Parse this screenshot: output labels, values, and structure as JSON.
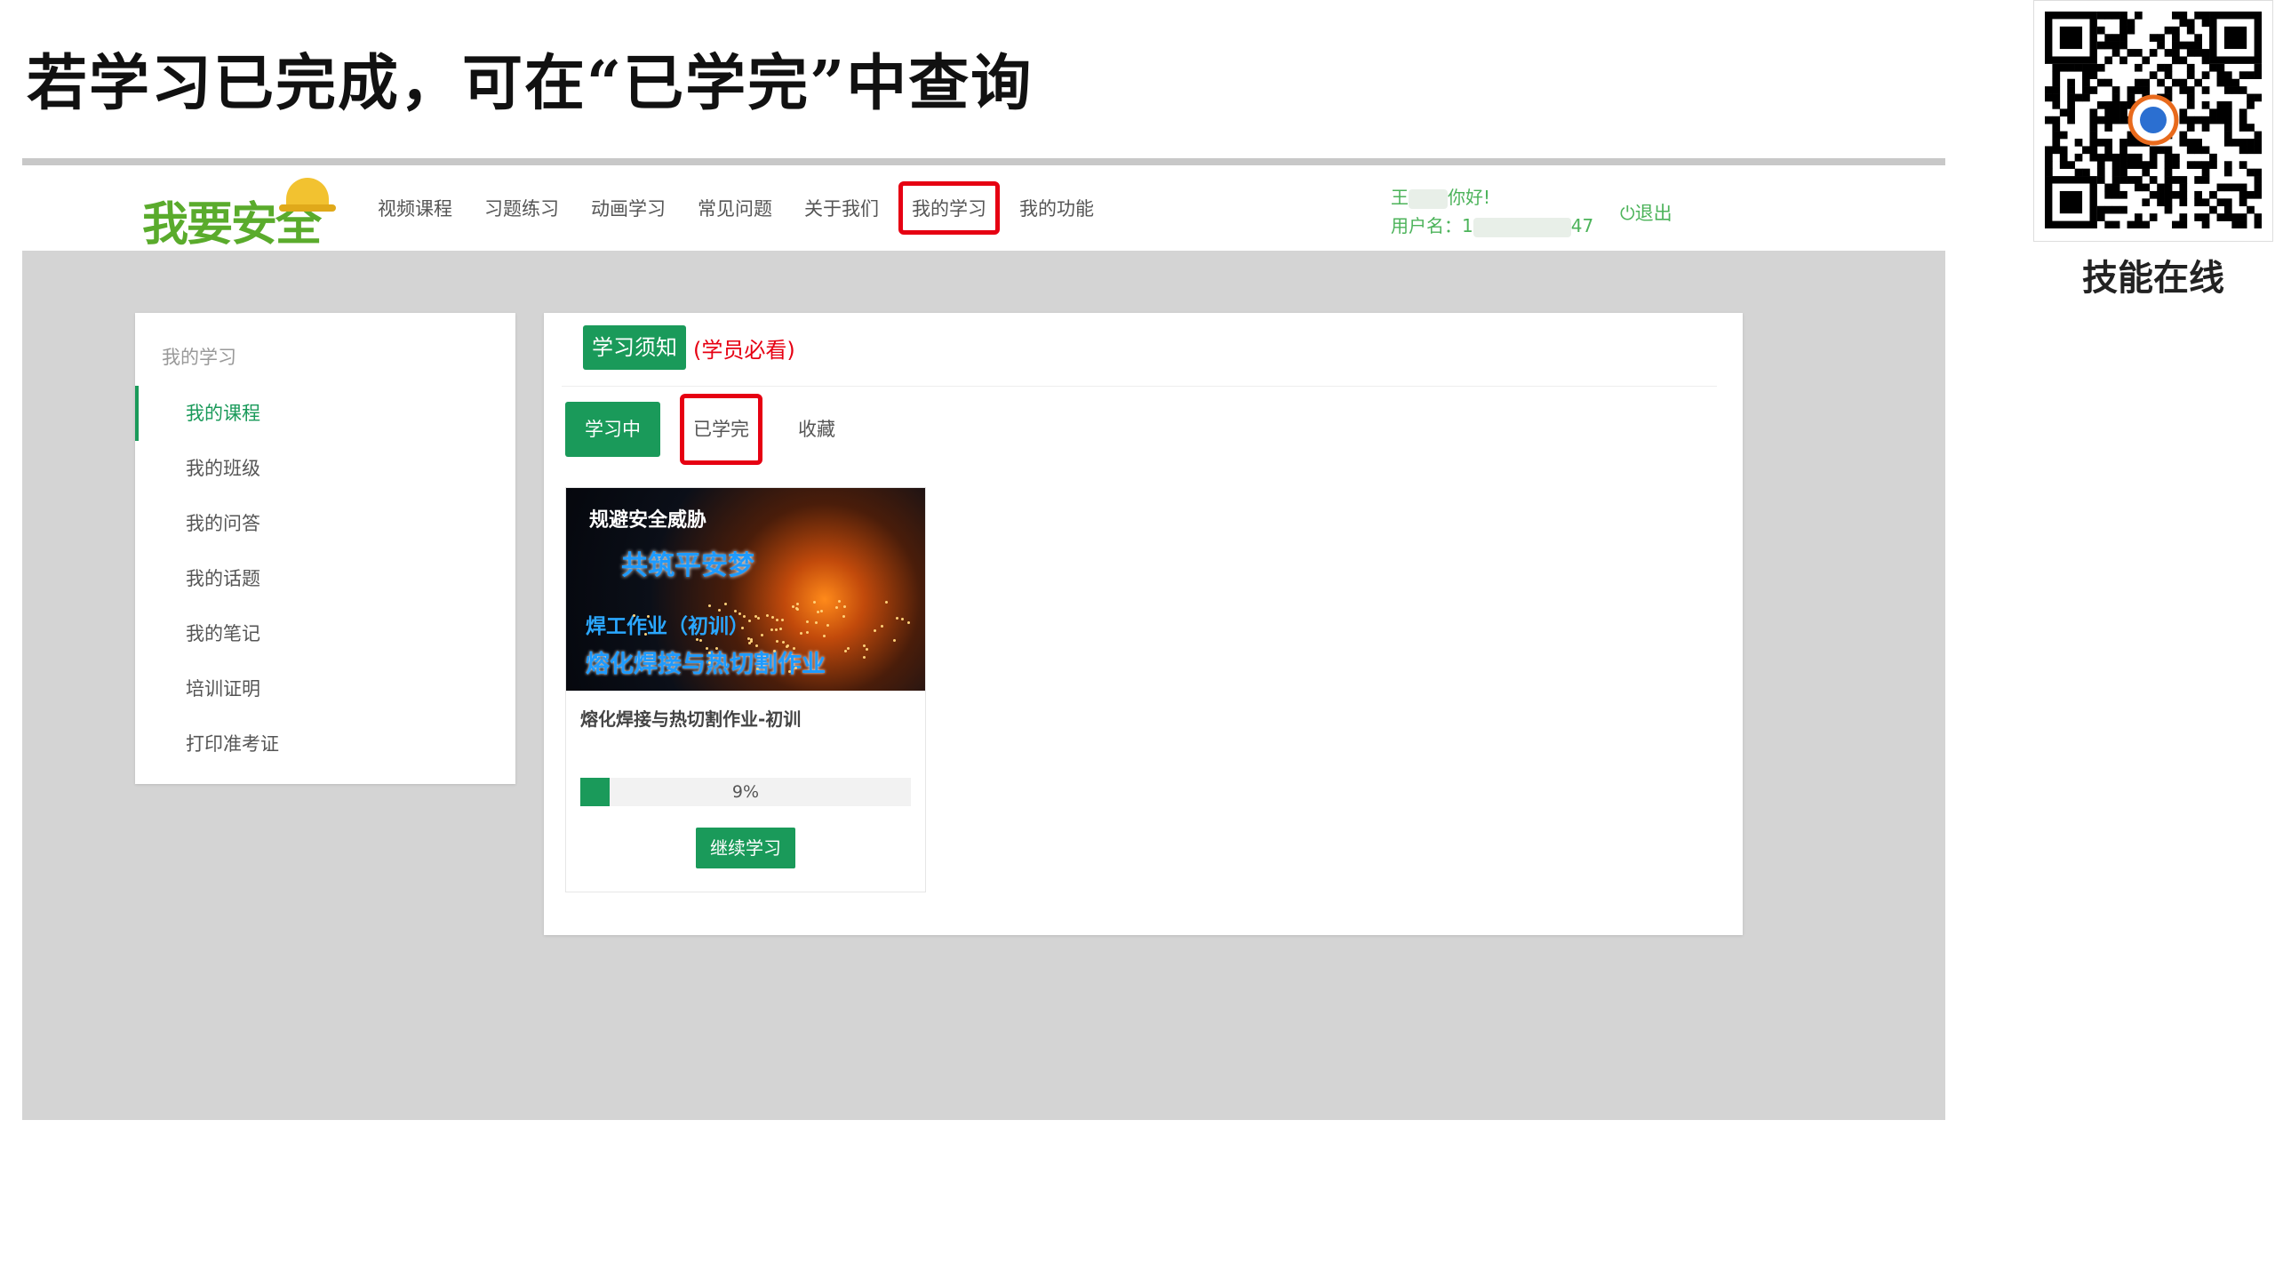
{
  "slide": {
    "title": "若学习已完成，可在“已学完”中查询",
    "brand": "技能在线"
  },
  "header": {
    "logo_text": "我要安全",
    "nav": [
      {
        "label": "视频课程"
      },
      {
        "label": "习题练习"
      },
      {
        "label": "动画学习"
      },
      {
        "label": "常见问题"
      },
      {
        "label": "关于我们"
      },
      {
        "label": "我的学习"
      },
      {
        "label": "我的功能"
      }
    ],
    "greeting_prefix": "王",
    "greeting_suffix": "你好!",
    "username_label": "用户名：1",
    "username_tail": "47",
    "logout": "退出"
  },
  "sidebar": {
    "title": "我的学习",
    "items": [
      {
        "label": "我的课程"
      },
      {
        "label": "我的班级"
      },
      {
        "label": "我的问答"
      },
      {
        "label": "我的话题"
      },
      {
        "label": "我的笔记"
      },
      {
        "label": "培训证明"
      },
      {
        "label": "打印准考证"
      }
    ]
  },
  "main": {
    "notice_label": "学习须知",
    "notice_note": "(学员必看)",
    "tabs": [
      {
        "label": "学习中"
      },
      {
        "label": "已学完"
      },
      {
        "label": "收藏"
      }
    ],
    "course": {
      "image_line1": "规避安全威胁",
      "image_line2": "共筑平安梦",
      "image_line3": "焊工作业（初训）",
      "image_line4": "熔化焊接与热切割作业",
      "title": "熔化焊接与热切割作业-初训",
      "progress_percent": 9,
      "progress_label": "9%",
      "continue_label": "继续学习"
    }
  },
  "colors": {
    "accent_green": "#1a9a5a",
    "highlight_red": "#e60012",
    "logo_green": "#5aab2c",
    "user_green": "#4cb35a"
  }
}
